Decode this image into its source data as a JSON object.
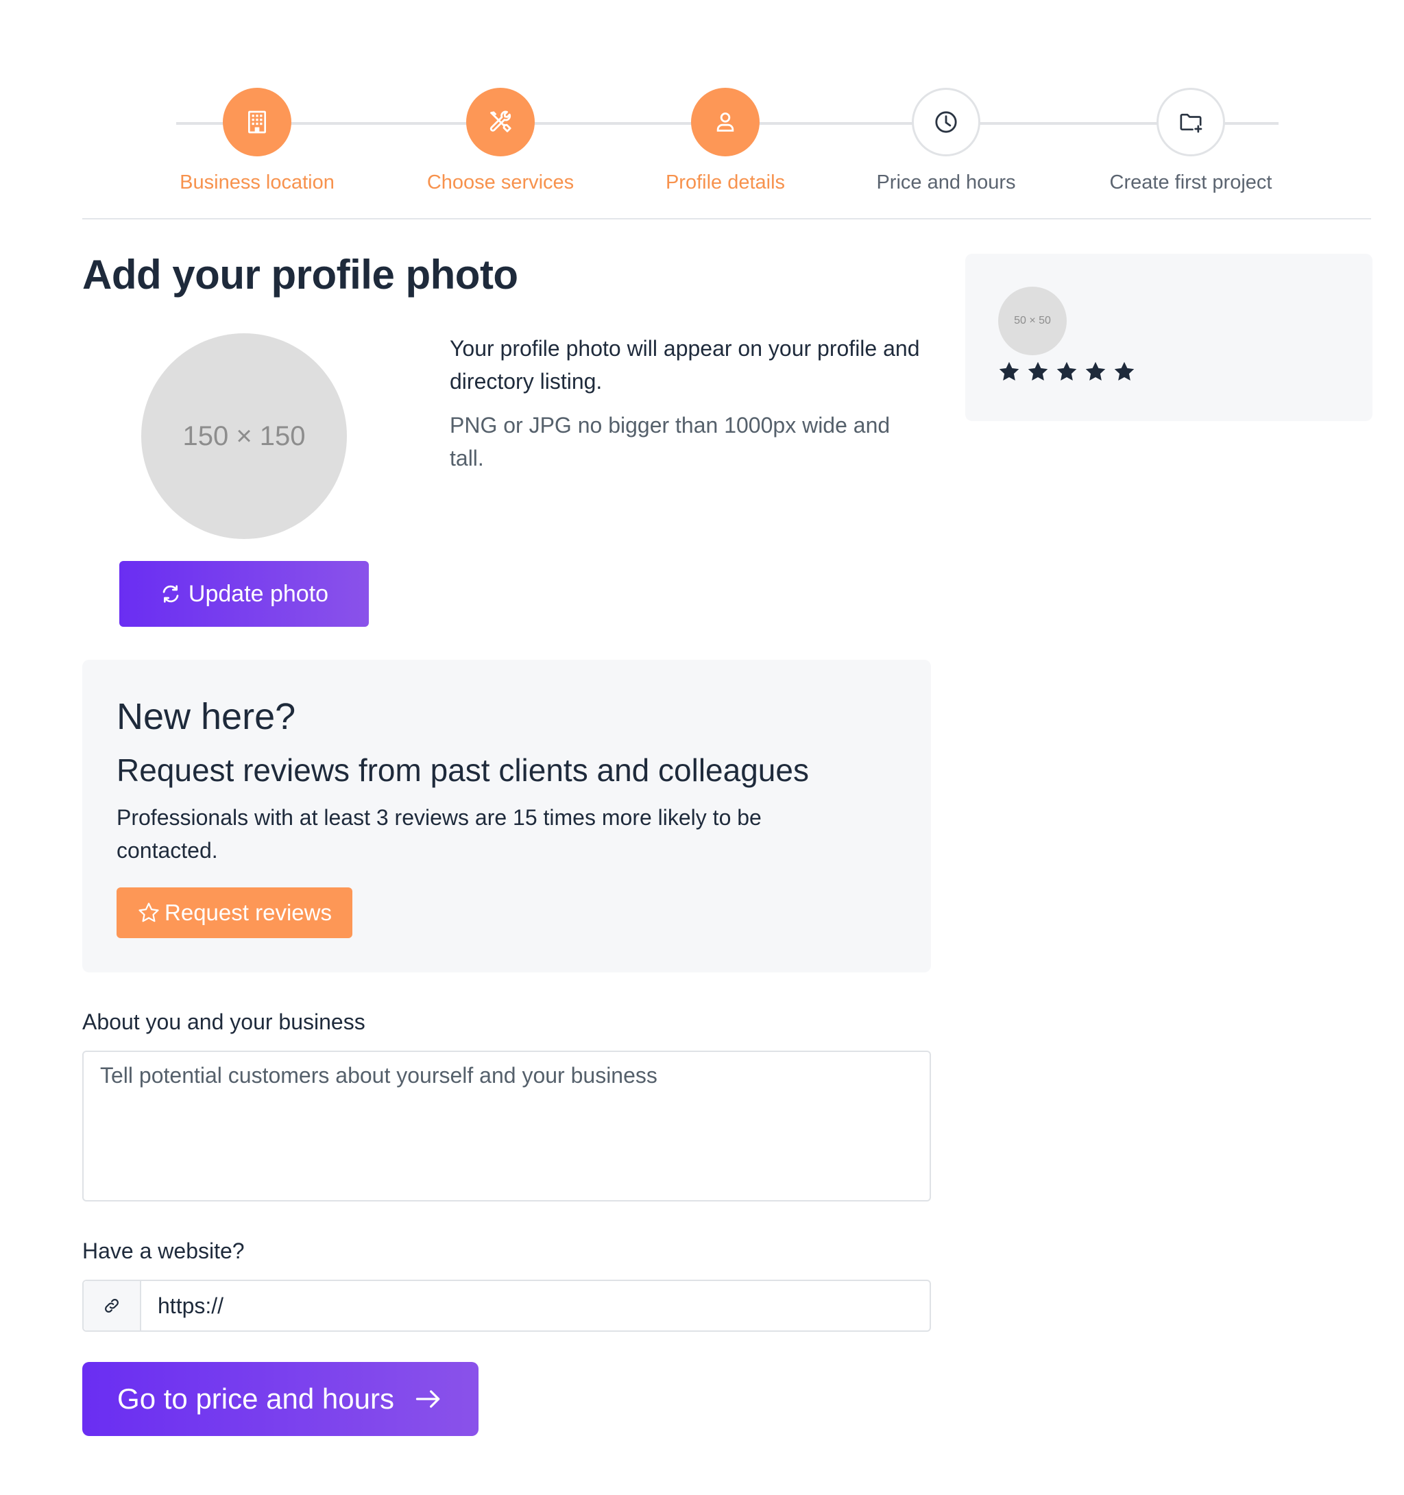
{
  "stepper": {
    "steps": [
      {
        "label": "Business location",
        "icon": "building-icon",
        "state": "done"
      },
      {
        "label": "Choose services",
        "icon": "tools-icon",
        "state": "done"
      },
      {
        "label": "Profile details",
        "icon": "user-icon",
        "state": "current"
      },
      {
        "label": "Price and hours",
        "icon": "clock-icon",
        "state": "pending"
      },
      {
        "label": "Create first project",
        "icon": "folder-plus-icon",
        "state": "pending"
      }
    ]
  },
  "colors": {
    "accent_orange": "#fd9756",
    "accent_purple": "#6a2ef2",
    "text_dark": "#1e2a3b"
  },
  "main": {
    "title": "Add your profile photo",
    "photo_placeholder": "150 × 150",
    "photo_description": "Your profile photo will appear on your profile and directory listing.",
    "photo_hint": "PNG or JPG no bigger than 1000px wide and tall.",
    "update_button": "Update photo"
  },
  "preview": {
    "avatar_placeholder": "50 × 50",
    "rating": 5
  },
  "new_here": {
    "title": "New here?",
    "subtitle": "Request reviews from past clients and colleagues",
    "text": "Professionals with at least 3 reviews are 15 times more likely to be contacted.",
    "button": "Request reviews"
  },
  "form": {
    "about_label": "About you and your business",
    "about_placeholder": "Tell potential customers about yourself and your business",
    "website_label": "Have a website?",
    "website_placeholder": "https://",
    "next_button": "Go to price and hours"
  }
}
